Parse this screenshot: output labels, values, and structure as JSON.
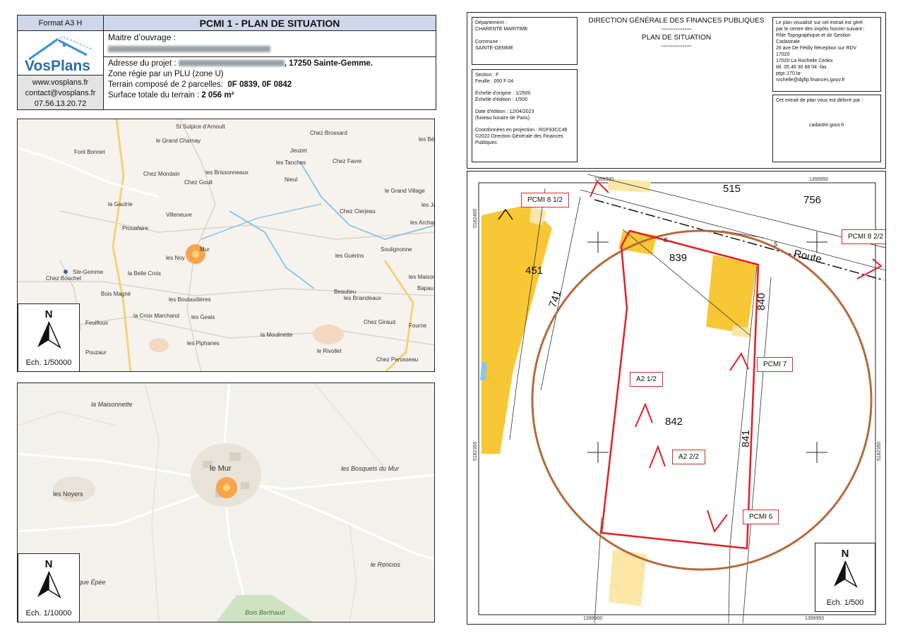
{
  "header": {
    "format": "Format A3 H",
    "title": "PCMI 1 - PLAN DE SITUATION",
    "maitre_ouvrage_label": "Maitre d’ouvrage :",
    "adresse_label": "Adresse du projet :",
    "adresse_value": ", 17250 Sainte-Gemme.",
    "zone": "Zone régie par un PLU (zone U)",
    "terrain_label": "Terrain composé de 2 parcelles:",
    "terrain_value": "0F 0839, 0F 0842",
    "surface_label": "Surface totale du terrain :",
    "surface_value": "2 056 m²",
    "logo_text": "VosPlans",
    "website": "www.vosplans.fr",
    "email": "contact@vosplans.fr",
    "phone": "07.56.13.20.72"
  },
  "map1": {
    "north": "N",
    "scale": "Ech. 1/50000",
    "labels": [
      "St Sulpice d'Arnoult",
      "Chez Brossard",
      "le Grand Charnay",
      "les Bés",
      "Font Bonnet",
      "Jeuzet",
      "les Tanches",
      "Chez Favre",
      "Chez Mondain",
      "les Brissonneaux",
      "Chez Goult",
      "Nieul",
      "le Grand Village",
      "la Gautrie",
      "Villeneuve",
      "les Jarr",
      "Chez Clerjeau",
      "Prouafaire",
      "les Archamb",
      "Soulignonne",
      "les Noy",
      "Mur",
      "les Guérins",
      "Ste-Gemme",
      "la Belle Croix",
      "les Maisons Ne",
      "Chez Bouchet",
      "Bois Magné",
      "Beaulieu",
      "les Briandeaux",
      "Bapau",
      "les Boutaudières",
      "la Croix Marchand",
      "les Geais",
      "Chez Giraud",
      "Fourne",
      "Feuilloux",
      "la Moulinette",
      "les Piphanes",
      "le Rivollet",
      "Pouzaur",
      "Chez Perusseau"
    ]
  },
  "map2": {
    "north": "N",
    "scale": "Ech. 1/10000",
    "labels": [
      "la Maisonnette",
      "le Mur",
      "les Bosquets du Mur",
      "les Noyers",
      "le Rencios",
      "que Épée",
      "Bois Berthaud"
    ]
  },
  "cadastre": {
    "dept_label": "Département :",
    "dept_value": "CHARENTE MARITIME",
    "commune_label": "Commune :",
    "commune_value": "SAINTE-GEMME",
    "main_title": "DIRECTION GÉNÉRALE DES FINANCES PUBLIQUES",
    "sep": "-------------",
    "sub_title": "PLAN DE SITUATION",
    "section": "Section : F",
    "feuille": "Feuille : 000 F 04",
    "echelle_origine": "Échelle d'origine : 1/2500",
    "echelle_edition": "Échelle d'édition : 1/500",
    "date_edition": "Date d'édition : 12/04/2023",
    "fuseau": "(fuseau horaire de Paris)",
    "projection": "Coordonnées en projection : RGF93CC46",
    "copyright": "©2022 Direction Générale des Finances Publiques",
    "centre_lines": [
      "Le plan visualisé sur cet extrait est géré",
      "par le centre des impôts foncier suivant :",
      "Pôle Topographique et de Gestion",
      "Cadastrale",
      "26 ave De Fétilly Réception sur RDV",
      "17020",
      "17020 La Rochelle Cédex",
      "tél. 05 46 30 68 04 -fax",
      "ptgc.170.la-",
      "rochelle@dgfip.finances.gouv.fr"
    ],
    "delivre": "Cet extrait de plan vous est délivré par :",
    "site": "cadastre.gouv.fr"
  },
  "plan": {
    "coords": [
      "1399900",
      "1399950",
      "5182400",
      "5182350",
      "1399900",
      "1399950",
      "5182350"
    ],
    "parcels": [
      "515",
      "756",
      "839",
      "451",
      "741",
      "840",
      "842",
      "841",
      "8",
      "5"
    ],
    "route": "Route",
    "labels": [
      "PCMI 8 1/2",
      "PCMI 8 2/2",
      "PCMI 7",
      "A2 1/2",
      "A2 2/2",
      "PCMI 6"
    ],
    "north": "N",
    "scale": "Ech. 1/500"
  }
}
